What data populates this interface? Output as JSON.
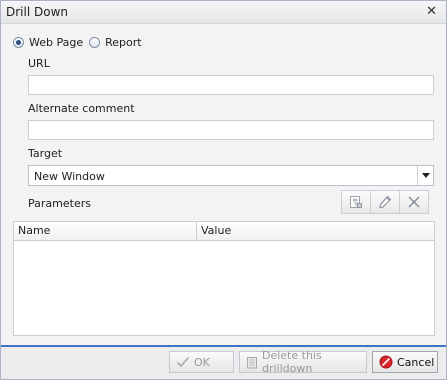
{
  "dialog": {
    "title": "Drill Down"
  },
  "link_type": {
    "options": [
      {
        "label": "Web Page",
        "checked": true
      },
      {
        "label": "Report",
        "checked": false
      }
    ]
  },
  "fields": {
    "url": {
      "label": "URL",
      "value": ""
    },
    "alternate_comment": {
      "label": "Alternate comment",
      "value": ""
    },
    "target": {
      "label": "Target",
      "value": "New Window"
    }
  },
  "parameters": {
    "label": "Parameters",
    "columns": [
      "Name",
      "Value"
    ],
    "rows": []
  },
  "buttons": {
    "ok": "OK",
    "delete": "Delete this drilldown",
    "cancel": "Cancel"
  },
  "icons": {
    "close": "close-icon",
    "add_param": "add-parameter-icon",
    "edit_param": "pencil-icon",
    "delete_param": "x-icon",
    "ok": "checkmark-icon",
    "delete": "delete-drilldown-icon",
    "cancel": "no-entry-icon"
  }
}
